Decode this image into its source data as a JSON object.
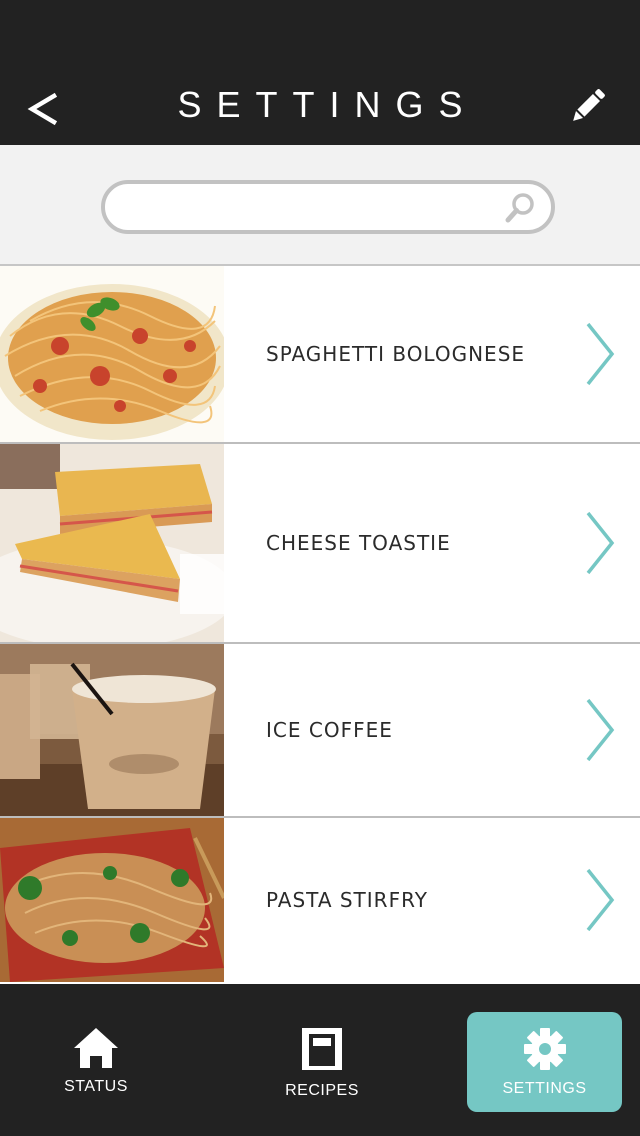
{
  "header": {
    "title": "SETTINGS",
    "back_icon": "chevron-left-icon",
    "edit_icon": "pencil-icon"
  },
  "search": {
    "value": "",
    "placeholder": "",
    "icon": "search-icon"
  },
  "recipes": [
    {
      "label": "SPAGHETTI BOLOGNESE",
      "image": "spaghetti-bolognese-image"
    },
    {
      "label": "CHEESE TOASTIE",
      "image": "cheese-toastie-image"
    },
    {
      "label": "ICE COFFEE",
      "image": "ice-coffee-image"
    },
    {
      "label": "PASTA STIRFRY",
      "image": "pasta-stirfry-image"
    }
  ],
  "tabbar": {
    "tabs": [
      {
        "label": "STATUS",
        "icon": "home-icon",
        "active": false
      },
      {
        "label": "RECIPES",
        "icon": "book-icon",
        "active": false
      },
      {
        "label": "SETTINGS",
        "icon": "gear-icon",
        "active": true
      }
    ]
  },
  "colors": {
    "header_bg": "#222222",
    "accent": "#75c7c4",
    "search_bg": "#f2f2f2",
    "chevron": "#75c7c4"
  }
}
